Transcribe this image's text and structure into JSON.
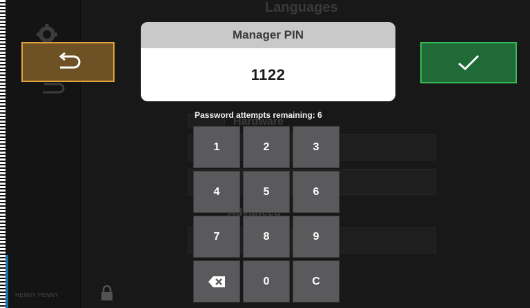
{
  "background": {
    "title": "Languages",
    "sections": [
      "Hardware",
      "Advanced"
    ],
    "brand": "HENNY PENNY"
  },
  "buttons": {
    "back_icon": "undo-arrow-icon",
    "confirm_icon": "checkmark-icon"
  },
  "pin_dialog": {
    "title": "Manager PIN",
    "value": "1122",
    "attempts_text": "Password attempts remaining: 6"
  },
  "keypad": {
    "keys": [
      "1",
      "2",
      "3",
      "4",
      "5",
      "6",
      "7",
      "8",
      "9",
      "",
      "0",
      "C"
    ],
    "backspace_icon": "backspace-icon"
  },
  "colors": {
    "back_button": "#6e5225",
    "back_border": "#e2a33a",
    "confirm_button": "#1f6a36",
    "confirm_border": "#35b956",
    "key": "#5a5a5c"
  }
}
